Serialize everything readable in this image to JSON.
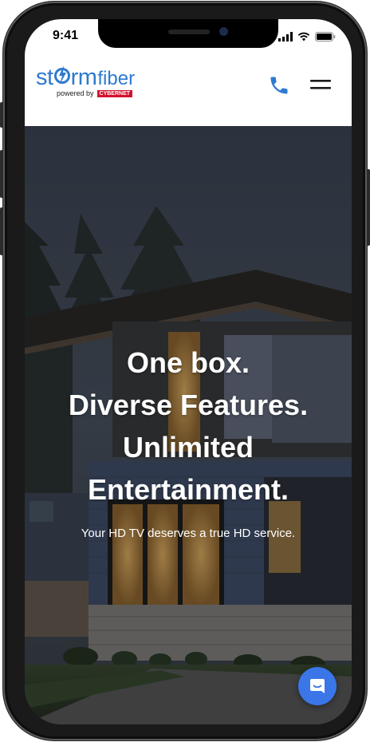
{
  "status": {
    "time": "9:41"
  },
  "header": {
    "brand_part1": "st",
    "brand_part2": "rm",
    "brand_part3": "fiber",
    "powered_by": "powered by",
    "powered_brand": "CYBERNET",
    "brand_color": "#2e7ad0",
    "partner_color": "#d3122e"
  },
  "hero": {
    "headline_lines": [
      "One box.",
      "Diverse Features.",
      "Unlimited",
      "Entertainment."
    ],
    "subline": "Your HD TV deserves a true HD service."
  },
  "icons": {
    "call": "phone-icon",
    "menu": "hamburger-menu-icon",
    "chat": "chat-icon"
  },
  "colors": {
    "accent": "#2e7ad0",
    "chat_button": "#3a76e8"
  }
}
